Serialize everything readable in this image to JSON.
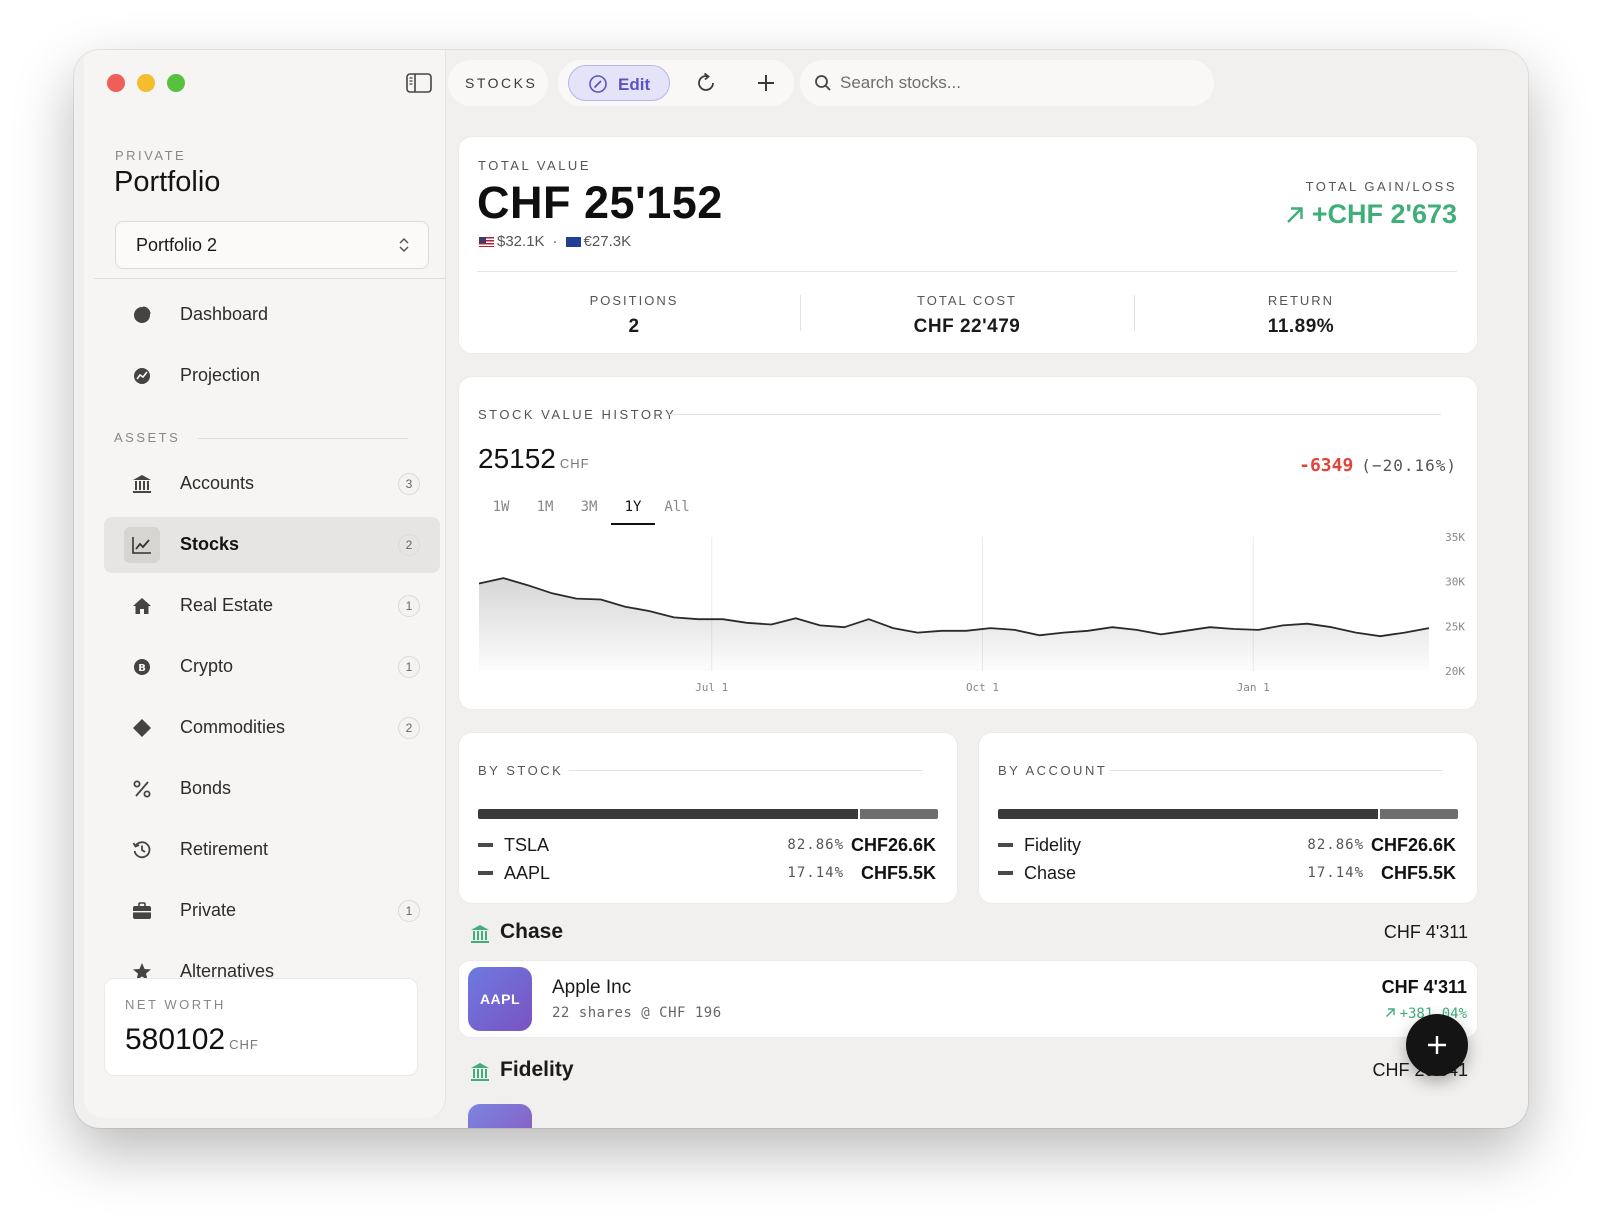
{
  "window": {
    "toolbar_title": "STOCKS",
    "edit_label": "Edit",
    "search_placeholder": "Search stocks..."
  },
  "sidebar": {
    "eyebrow": "PRIVATE",
    "title": "Portfolio",
    "selected_portfolio": "Portfolio 2",
    "top_items": [
      {
        "label": "Dashboard",
        "icon": "pie-chart-icon"
      },
      {
        "label": "Projection",
        "icon": "projection-chart-icon"
      }
    ],
    "section_label": "ASSETS",
    "items": [
      {
        "label": "Accounts",
        "badge": "3",
        "icon": "bank-icon"
      },
      {
        "label": "Stocks",
        "badge": "2",
        "icon": "line-chart-icon",
        "active": true
      },
      {
        "label": "Real Estate",
        "badge": "1",
        "icon": "house-icon"
      },
      {
        "label": "Crypto",
        "badge": "1",
        "icon": "bitcoin-icon"
      },
      {
        "label": "Commodities",
        "badge": "2",
        "icon": "diamond-icon"
      },
      {
        "label": "Bonds",
        "badge": "",
        "icon": "percent-icon"
      },
      {
        "label": "Retirement",
        "badge": "",
        "icon": "clock-history-icon"
      },
      {
        "label": "Private",
        "badge": "1",
        "icon": "briefcase-icon"
      },
      {
        "label": "Alternatives",
        "badge": "",
        "icon": "star-icon"
      }
    ],
    "net_worth": {
      "label": "NET WORTH",
      "value": "580102",
      "currency": "CHF"
    }
  },
  "summary": {
    "label": "TOTAL VALUE",
    "value": "CHF 25'152",
    "usd": "$32.1K",
    "separator": "·",
    "eur": "€27.3K",
    "gain_label": "TOTAL GAIN/LOSS",
    "gain_value": "+CHF 2'673",
    "stats": [
      {
        "label": "POSITIONS",
        "value": "2"
      },
      {
        "label": "TOTAL COST",
        "value": "CHF 22'479"
      },
      {
        "label": "RETURN",
        "value": "11.89%"
      }
    ]
  },
  "history": {
    "title": "STOCK VALUE HISTORY",
    "value": "25152",
    "currency": "CHF",
    "delta": "-6349",
    "delta_pct": "(−20.16%)",
    "ranges": [
      "1W",
      "1M",
      "3M",
      "1Y",
      "All"
    ],
    "active_range": "1Y"
  },
  "chart_data": {
    "type": "area",
    "title": "STOCK VALUE HISTORY",
    "x_ticks": [
      "Jul 1",
      "Oct 1",
      "Jan 1"
    ],
    "y_ticks": [
      "35K",
      "30K",
      "25K",
      "20K"
    ],
    "ylim": [
      20000,
      35000
    ],
    "grid": true,
    "series": [
      {
        "values": [
          29800,
          30400,
          29600,
          28700,
          28100,
          28000,
          27200,
          26700,
          26000,
          25800,
          25800,
          25400,
          25200,
          25900,
          25100,
          24900,
          25800,
          24800,
          24300,
          24500,
          24500,
          24800,
          24600,
          24000,
          24300,
          24500,
          24900,
          24600,
          24100,
          24500,
          24900,
          24700,
          24600,
          25100,
          25300,
          24900,
          24300,
          23900,
          24300,
          24800
        ]
      }
    ]
  },
  "by_stock": {
    "title": "BY STOCK",
    "rows": [
      {
        "name": "TSLA",
        "pct": "82.86%",
        "amount": "CHF26.6K",
        "share": 82.86
      },
      {
        "name": "AAPL",
        "pct": "17.14%",
        "amount": "CHF5.5K",
        "share": 17.14
      }
    ]
  },
  "by_account": {
    "title": "BY ACCOUNT",
    "rows": [
      {
        "name": "Fidelity",
        "pct": "82.86%",
        "amount": "CHF26.6K",
        "share": 82.86
      },
      {
        "name": "Chase",
        "pct": "17.14%",
        "amount": "CHF5.5K",
        "share": 17.14
      }
    ]
  },
  "groups": [
    {
      "name": "Chase",
      "amount": "CHF 4'311",
      "holding": {
        "ticker": "AAPL",
        "name": "Apple Inc",
        "detail": "22 shares @ CHF 196",
        "amount": "CHF 4'311",
        "change": "+381.04%"
      }
    },
    {
      "name": "Fidelity",
      "amount": "CHF 20'841"
    }
  ],
  "colors": {
    "accent": "#5a55c4",
    "positive": "#3fae78",
    "negative": "#e0453b"
  }
}
